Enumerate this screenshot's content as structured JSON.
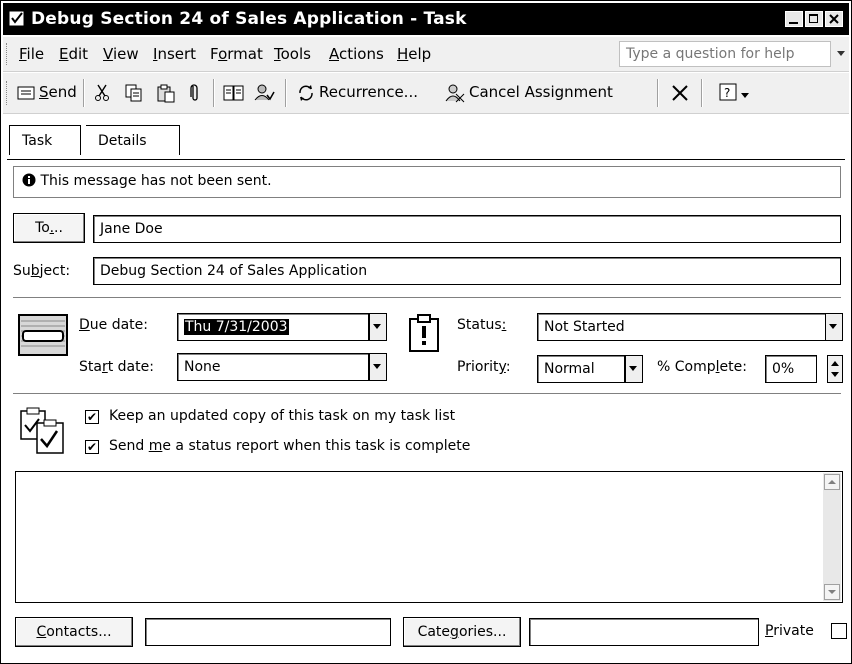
{
  "window": {
    "title": "Debug Section 24 of Sales Application - Task"
  },
  "menu": {
    "items": [
      "File",
      "Edit",
      "View",
      "Insert",
      "Format",
      "Tools",
      "Actions",
      "Help"
    ],
    "help_placeholder": "Type a question for help"
  },
  "toolbar": {
    "send": "Send",
    "recurrence": "Recurrence...",
    "cancel_assignment": "Cancel Assignment"
  },
  "tabs": [
    "Task",
    "Details"
  ],
  "info": {
    "message": "This message has not been sent."
  },
  "to": {
    "button": "To...",
    "value": "Jane Doe"
  },
  "subject": {
    "label": "Subject:",
    "value": "Debug Section 24 of Sales Application"
  },
  "dates": {
    "due_label": "Due date:",
    "due_value": "Thu 7/31/2003",
    "start_label": "Start date:",
    "start_value": "None"
  },
  "status": {
    "label": "Status:",
    "value": "Not Started"
  },
  "priority": {
    "label": "Priority:",
    "value": "Normal",
    "complete_label": "% Complete:",
    "complete_value": "0%"
  },
  "options": {
    "keep_copy": "Keep an updated copy of this task on my task list",
    "status_report": "Send me a status report when this task is complete",
    "keep_copy_checked": true,
    "status_report_checked": true
  },
  "footer": {
    "contacts": "Contacts...",
    "categories": "Categories...",
    "private": "Private"
  }
}
